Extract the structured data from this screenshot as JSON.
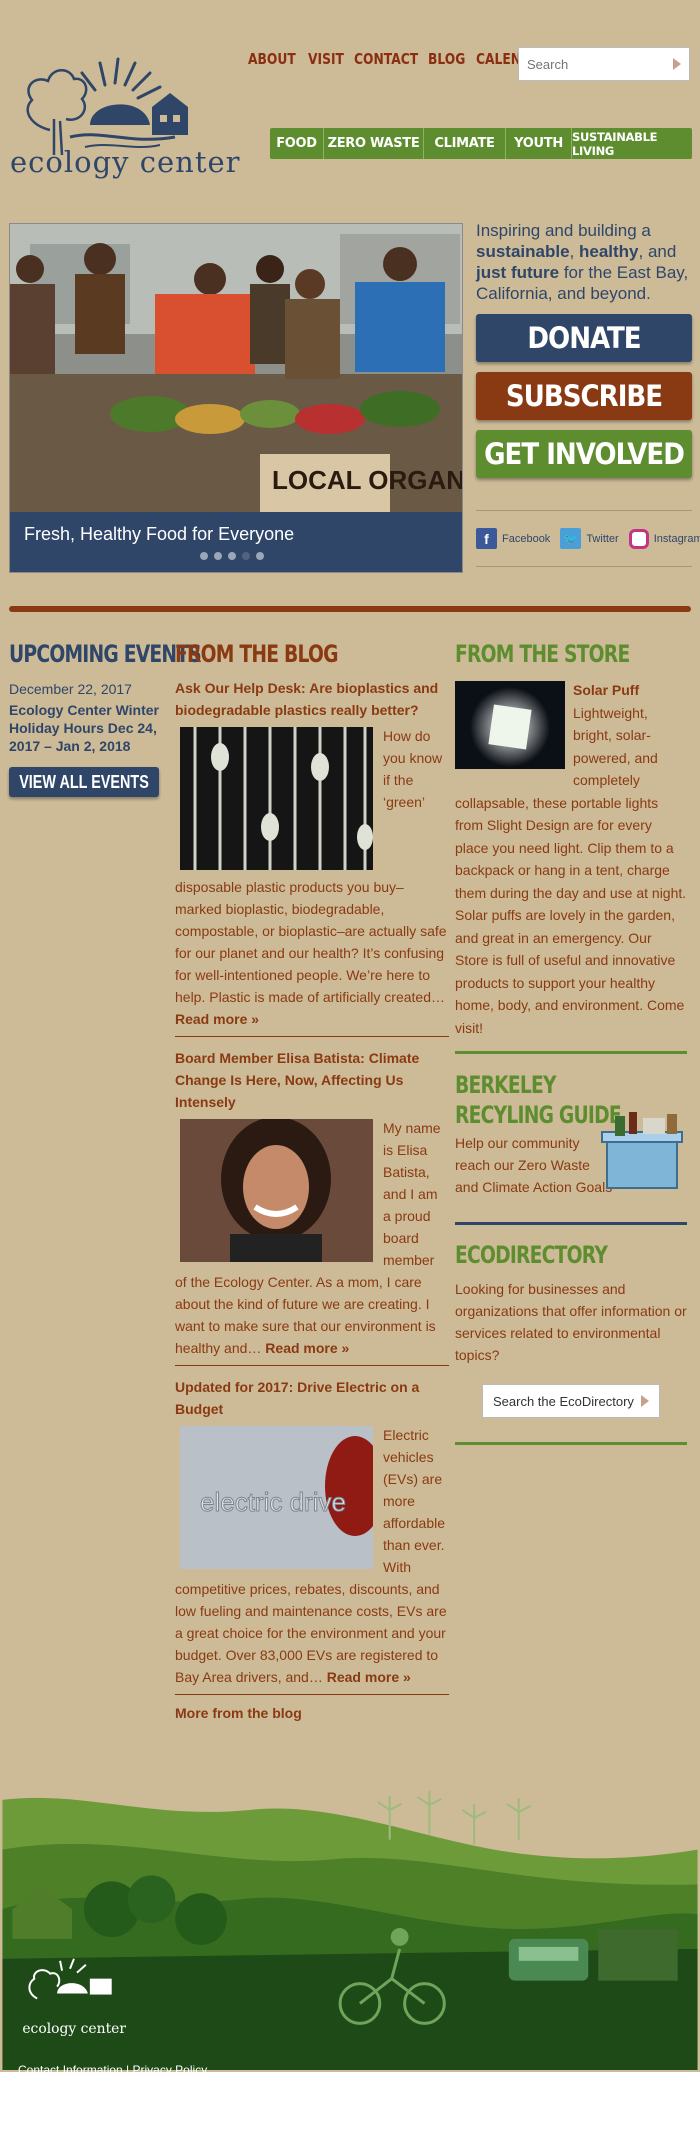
{
  "site": {
    "name": "ecology center"
  },
  "topnav": [
    "ABOUT",
    "VISIT",
    "CONTACT",
    "BLOG",
    "CALENDAR"
  ],
  "search": {
    "placeholder": "Search"
  },
  "greennav": [
    "FOOD",
    "ZERO WASTE",
    "CLIMATE",
    "YOUTH",
    "SUSTAINABLE LIVING"
  ],
  "hero": {
    "caption": "Fresh, Healthy Food for Everyone",
    "sign_text": "LOCAL ORGANIC",
    "slide_count": 5,
    "active_slide": 4
  },
  "tagline": {
    "t1": "Inspiring and building a ",
    "b1": "sustainable",
    "t2": ", ",
    "b2": "healthy",
    "t3": ", and ",
    "b3": "just future",
    "t4": " for the East Bay, California, and beyond."
  },
  "cta": {
    "donate": "DONATE",
    "subscribe": "SUBSCRIBE",
    "involved": "GET INVOLVED"
  },
  "social": {
    "facebook": "Facebook",
    "twitter": "Twitter",
    "instagram": "Instagram"
  },
  "events": {
    "heading": "UPCOMING EVENTS",
    "date": "December 22, 2017",
    "title": "Ecology Center Winter Holiday Hours Dec 24, 2017 – Jan 2, 2018",
    "button": "VIEW ALL EVENTS"
  },
  "blog": {
    "heading": "FROM THE BLOG",
    "posts": [
      {
        "title": "Ask Our Help Desk: Are bioplastics and biodegradable plastics really better?",
        "body": "How do you know if the ‘green’ disposable plastic products you buy–marked bioplastic, biodegradable, compostable, or bioplastic–are actually safe for our planet and our health? It’s confusing for well-intentioned people. We’re here to help. Plastic is made of artificially created…",
        "read_more": "Read more »"
      },
      {
        "title": "Board Member Elisa Batista: Climate Change Is Here, Now, Affecting Us Intensely",
        "body": "My name is Elisa Batista, and I am a proud board member of the Ecology Center. As a mom, I care about the kind of future we are creating. I want to make sure that our environment is healthy and…",
        "read_more": "Read more »"
      },
      {
        "title": "Updated for 2017: Drive Electric on a Budget",
        "body": "Electric vehicles (EVs) are more affordable than ever. With competitive prices, rebates, discounts, and low fueling and maintenance costs, EVs are a great choice for the environment and your budget. Over 83,000 EVs are registered to Bay Area drivers, and…",
        "read_more": "Read more »",
        "thumb_text": "electric drive"
      }
    ],
    "more": "More from the blog"
  },
  "store": {
    "heading": "FROM THE STORE",
    "product": "Solar Puff",
    "body": " Lightweight, bright, solar-powered, and completely collapsable, these portable lights from Slight Design are for every place you need light. Clip them to a backpack or hang in a tent, charge them during the day and use at night. Solar puffs are lovely in the garden, and great in an emergency. Our Store is full of useful and innovative products to support your healthy home, body, and environment. Come visit!"
  },
  "recycling": {
    "line1": "BERKELEY",
    "line2": "RECYLING GUIDE",
    "body": "Help our community reach our Zero Waste and Climate Action Goals"
  },
  "ecodirectory": {
    "heading": "ECODIRECTORY",
    "body": "Looking for businesses and organizations that offer information or services related to environmental topics?",
    "button": "Search the EcoDirectory"
  },
  "footer": {
    "logo_text": "ecology center",
    "links": "Contact Information | Privacy Policy"
  },
  "colors": {
    "navy": "#2f4669",
    "rust": "#8a3a12",
    "green": "#5e8d2f",
    "kraft": "#cdbb98"
  }
}
